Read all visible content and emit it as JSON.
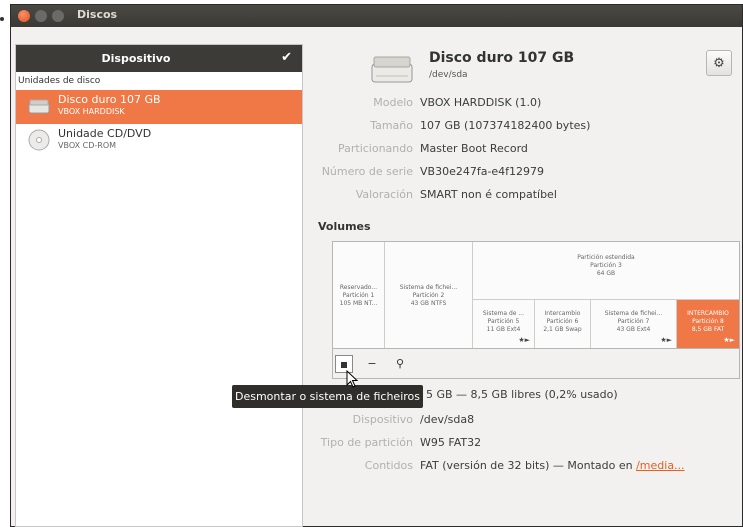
{
  "window": {
    "title": "Discos"
  },
  "sidebar": {
    "header": "Dispositivo",
    "section_label": "Unidades de disco",
    "items": [
      {
        "name": "Disco duro 107 GB",
        "sub": "VBOX HARDDISK",
        "selected": true,
        "icon": "hard-disk-icon"
      },
      {
        "name": "Unidade CD/DVD",
        "sub": "VBOX CD-ROM",
        "selected": false,
        "icon": "optical-disc-icon"
      }
    ]
  },
  "disk": {
    "title": "Disco duro 107 GB",
    "device": "/dev/sda",
    "props": [
      {
        "label": "Modelo",
        "value": "VBOX HARDDISK (1.0)"
      },
      {
        "label": "Tamaño",
        "value": "107 GB (107374182400 bytes)"
      },
      {
        "label": "Particionando",
        "value": "Master Boot Record"
      },
      {
        "label": "Número de serie",
        "value": "VB30e247fa-e4f12979"
      },
      {
        "label": "Valoración",
        "value": "SMART non é compatíbel"
      }
    ]
  },
  "volumes": {
    "title": "Volumes",
    "extended": {
      "l1": "Partición estendida",
      "l2": "Partición 3",
      "l3": "64 GB"
    },
    "blocks": [
      {
        "l1": "Reservado...",
        "l2": "Partición 1",
        "l3": "105 MB NT..."
      },
      {
        "l1": "Sistema de fichei...",
        "l2": "Partición 2",
        "l3": "43 GB NTFS"
      },
      {
        "l1": "Sistema de ...",
        "l2": "Partición 5",
        "l3": "11 GB Ext4"
      },
      {
        "l1": "Intercambio",
        "l2": "Partición 6",
        "l3": "2,1 GB Swap"
      },
      {
        "l1": "Sistema de fichei...",
        "l2": "Partición 7",
        "l3": "43 GB Ext4"
      },
      {
        "l1": "INTERCAMBIO",
        "l2": "Partición 8",
        "l3": "8,5 GB FAT"
      }
    ]
  },
  "toolbar": {
    "tooltip": "Desmontar o sistema de ficheiros",
    "minus": "−",
    "key": "🔑"
  },
  "details": {
    "size_value": "5 GB — 8,5 GB libres (0,2% usado)",
    "props": [
      {
        "label": "Dispositivo",
        "value": "/dev/sda8"
      },
      {
        "label": "Tipo de partición",
        "value": "W95 FAT32"
      },
      {
        "label": "Contidos",
        "value": "FAT (versión de 32 bits) — Montado en ",
        "link": "/media..."
      }
    ]
  },
  "colors": {
    "accent": "#f07746",
    "header": "#3c3b37"
  }
}
